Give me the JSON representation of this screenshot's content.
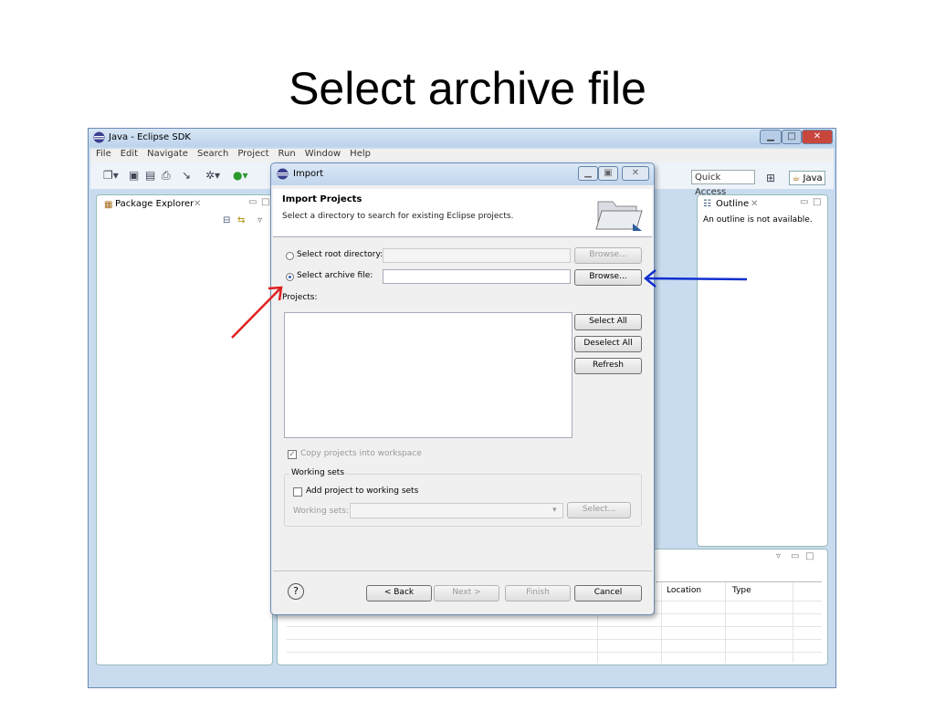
{
  "slide": {
    "title": "Select archive file"
  },
  "window": {
    "title": "Java - Eclipse SDK",
    "menu": [
      "File",
      "Edit",
      "Navigate",
      "Search",
      "Project",
      "Run",
      "Window",
      "Help"
    ],
    "quick_access": "Quick Access",
    "perspective": "Java"
  },
  "package_explorer": {
    "tab": "Package Explorer"
  },
  "outline": {
    "tab": "Outline",
    "message": "An outline is not available."
  },
  "bottom_panel": {
    "columns": [
      "Location",
      "Type"
    ]
  },
  "dialog": {
    "title": "Import",
    "heading": "Import Projects",
    "description": "Select a directory to search for existing Eclipse projects.",
    "root_dir_label": "Select root directory:",
    "archive_label": "Select archive file:",
    "browse": "Browse...",
    "projects_label": "Projects:",
    "select_all": "Select All",
    "deselect_all": "Deselect All",
    "refresh": "Refresh",
    "copy_projects": "Copy projects into workspace",
    "working_sets_group": "Working sets",
    "add_to_working_sets": "Add project to working sets",
    "working_sets_label": "Working sets:",
    "select": "Select...",
    "help": "?",
    "back": "< Back",
    "next": "Next >",
    "finish": "Finish",
    "cancel": "Cancel",
    "selected_option": "archive"
  },
  "colors": {
    "red_arrow": "#e02020",
    "blue_arrow": "#1030d0"
  }
}
